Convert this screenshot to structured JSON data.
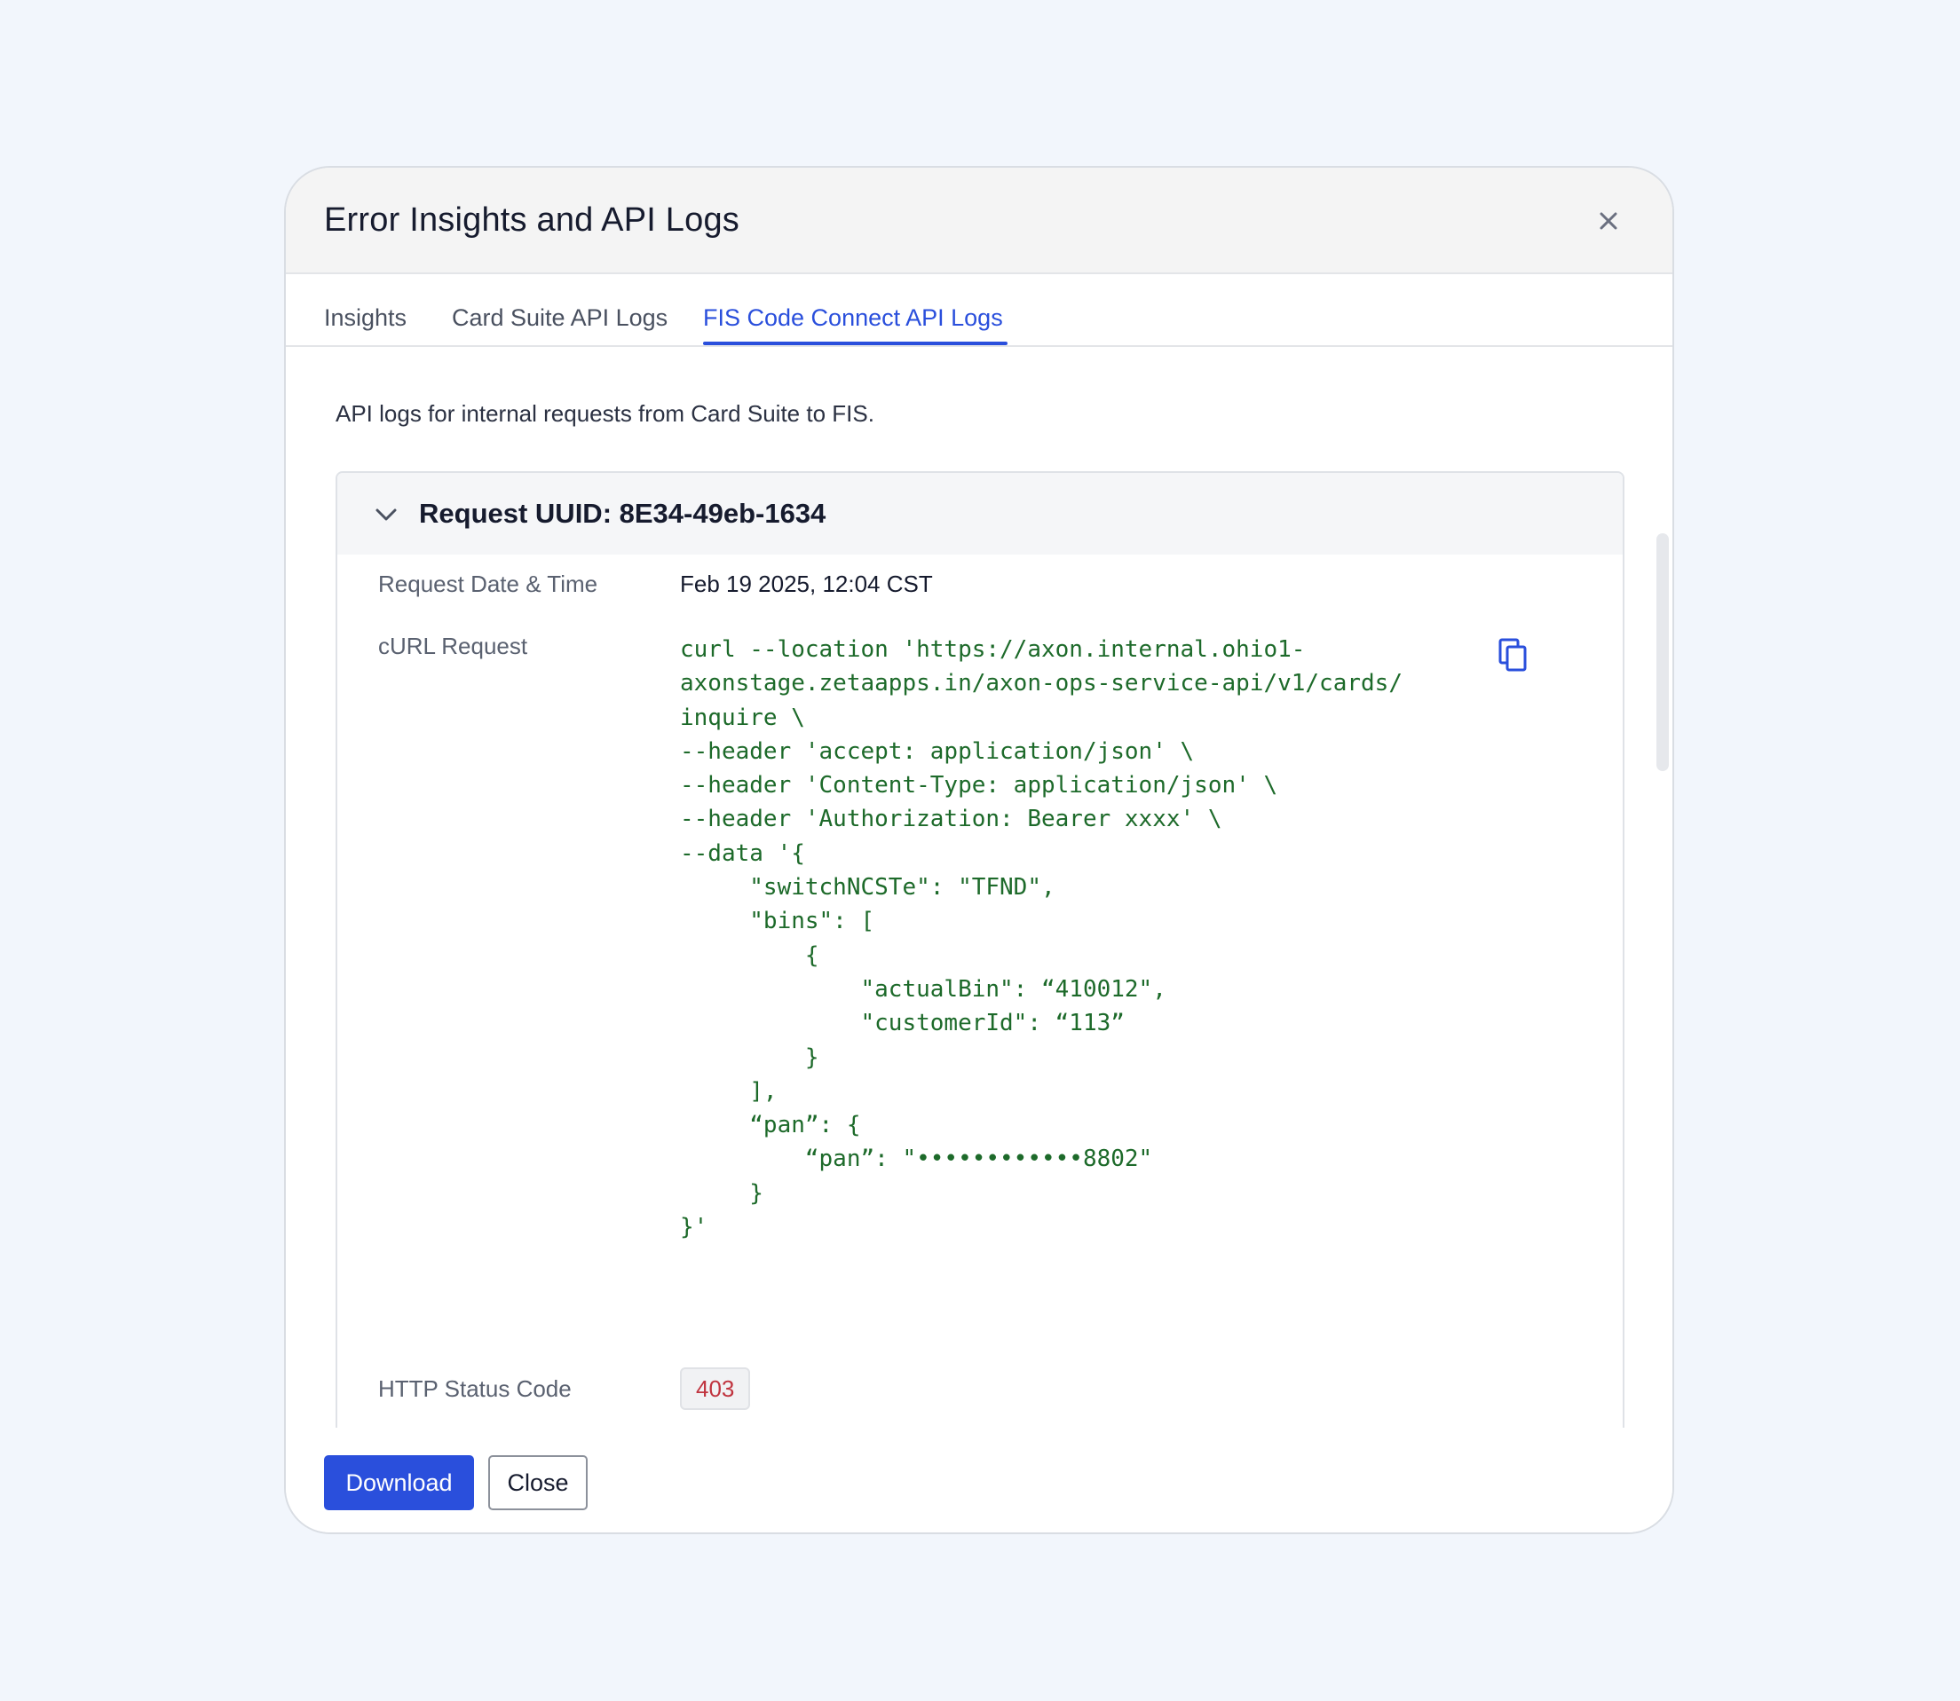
{
  "modal": {
    "title": "Error Insights and API Logs"
  },
  "tabs": [
    {
      "label": "Insights",
      "active": false
    },
    {
      "label": "Card Suite API Logs",
      "active": false
    },
    {
      "label": "FIS Code Connect API Logs",
      "active": true
    }
  ],
  "description": "API logs for internal requests from Card Suite to FIS.",
  "request": {
    "title": "Request UUID: 8E34-49eb-1634",
    "expanded": true,
    "date_label": "Request Date & Time",
    "date_value": "Feb 19 2025, 12:04 CST",
    "curl_label": "cURL Request",
    "curl_lines": [
      "curl --location 'https://axon.internal.ohio1-",
      "axonstage.zetaapps.in/axon-ops-service-api/v1/cards/",
      "inquire \\",
      "--header 'accept: application/json' \\",
      "--header 'Content-Type: application/json' \\",
      "--header 'Authorization: Bearer xxxx' \\",
      "--data '{",
      "     \"switchNCSTe\": \"TFND\",",
      "     \"bins\": [",
      "         {",
      "             \"actualBin\": “410012\",",
      "             \"customerId\": “113”",
      "         }",
      "     ],",
      "     “pan”: {",
      "         “pan”: \"••••••••••••8802\"",
      "     }",
      "}'"
    ],
    "status_label": "HTTP Status Code",
    "status_value": "403"
  },
  "footer": {
    "download_label": "Download",
    "close_label": "Close"
  },
  "colors": {
    "accent": "#2a4fdc",
    "code_text": "#1d6a2a",
    "status_error": "#c0343f",
    "page_background": "#f2f6fc"
  },
  "icons": {
    "close": "close-icon",
    "chevron": "chevron-down-icon",
    "copy": "copy-icon"
  }
}
